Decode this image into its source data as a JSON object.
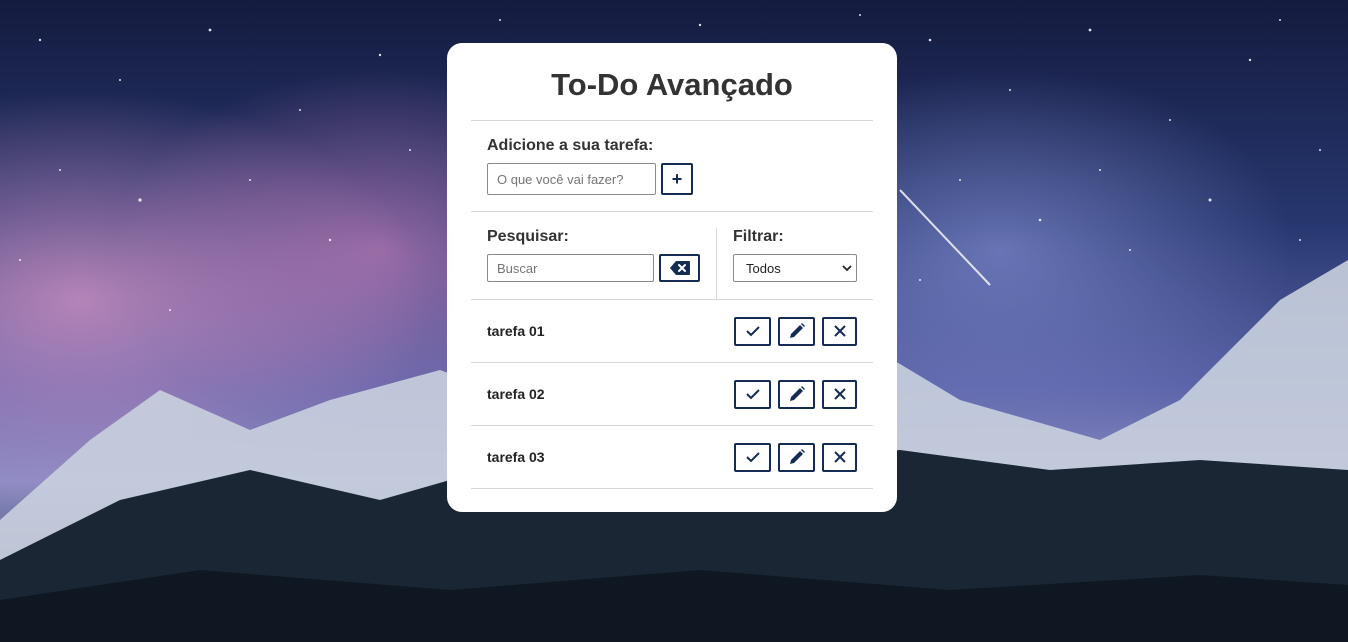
{
  "app": {
    "title": "To-Do Avançado"
  },
  "add_form": {
    "label": "Adicione a sua tarefa:",
    "input_placeholder": "O que você vai fazer?",
    "input_value": "",
    "add_button_label": "+"
  },
  "search": {
    "label": "Pesquisar:",
    "placeholder": "Buscar",
    "value": "",
    "erase_icon": "backspace-icon"
  },
  "filter": {
    "label": "Filtrar:",
    "selected": "Todos"
  },
  "todos": [
    {
      "title": "tarefa 01"
    },
    {
      "title": "tarefa 02"
    },
    {
      "title": "tarefa 03"
    }
  ],
  "todo_actions": {
    "finish_icon": "check-icon",
    "edit_icon": "pencil-icon",
    "remove_icon": "close-icon"
  },
  "colors": {
    "accent": "#142c53",
    "card_bg": "#ffffff",
    "text": "#333333",
    "divider": "#d6d6d6"
  }
}
